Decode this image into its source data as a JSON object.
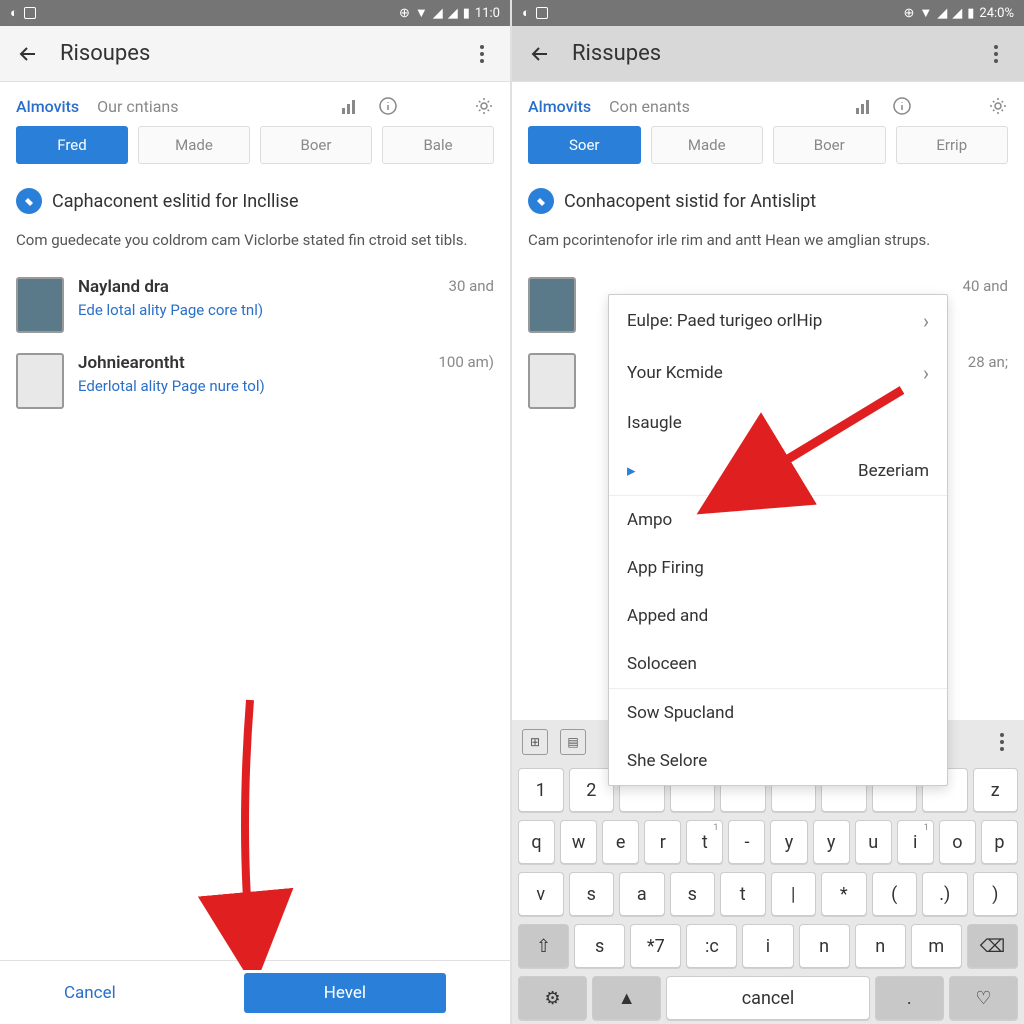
{
  "left": {
    "status": {
      "time": "11:0",
      "signal_glyph": "▲",
      "wifi_glyph": "▼"
    },
    "appbar": {
      "title": "Risoupes"
    },
    "tabs": {
      "a": "Almovits",
      "b": "Our cntians"
    },
    "chips": {
      "c1": "Fred",
      "c2": "Made",
      "c3": "Boer",
      "c4": "Bale"
    },
    "section": {
      "title": "Caphaconent eslitid for Incllise"
    },
    "desc": "Com guedecate you coldrom cam Viclorbe stated fin ctroid set tibls.",
    "items": [
      {
        "title": "Nayland dra",
        "sub": "Ede lotal ality Page core tnl)",
        "meta": "30 and"
      },
      {
        "title": "Johniearontht",
        "sub": "Ederlotal ality Page nure tol)",
        "meta": "100 am)"
      }
    ],
    "footer": {
      "cancel": "Cancel",
      "primary": "Hevel"
    }
  },
  "right": {
    "status": {
      "time": "24:0%"
    },
    "appbar": {
      "title": "Rissupes"
    },
    "tabs": {
      "a": "Almovits",
      "b": "Con enants"
    },
    "chips": {
      "c1": "Soer",
      "c2": "Made",
      "c3": "Boer",
      "c4": "Errip"
    },
    "section": {
      "title": "Conhacopent sistid for Antislipt"
    },
    "desc": "Cam pcorintenofor irle rim and antt Hean we amglian strups.",
    "items": [
      {
        "meta": "40 and"
      },
      {
        "meta": "28 an;"
      }
    ],
    "dropdown": [
      {
        "label": "Eulpe: Paed turigeo orlHip",
        "chevron": true
      },
      {
        "label": "Your Kcmide",
        "chevron": true
      },
      {
        "label": "Isaugle"
      },
      {
        "label": "Bezeriam",
        "marker": true
      },
      {
        "label": "Ampo",
        "sep": true
      },
      {
        "label": "App Firing"
      },
      {
        "label": "Apped and"
      },
      {
        "label": "Soloceen"
      },
      {
        "label": "Sow Spucland",
        "sep": true
      },
      {
        "label": "She Selore"
      }
    ],
    "keyboard": {
      "row1": [
        "1",
        "2",
        "",
        "",
        "",
        "",
        "",
        "",
        "",
        "z"
      ],
      "row1_sup": [
        "",
        "",
        "",
        "",
        "",
        "",
        "",
        "",
        "",
        ""
      ],
      "row2": [
        "q",
        "w",
        "e",
        "r",
        "t",
        "-",
        "y",
        "y",
        "u",
        "i",
        "o",
        "p"
      ],
      "row2_sup": [
        "",
        "",
        "",
        "",
        "1",
        "",
        "",
        "",
        "",
        "1",
        "",
        ""
      ],
      "row3": [
        "v",
        "s",
        "a",
        "s",
        "t",
        "|",
        "*",
        "(",
        ".)",
        ")"
      ],
      "row4": [
        "⇧",
        "s",
        "*7",
        ":c",
        "i",
        "n",
        "n",
        "m",
        "⌫"
      ],
      "row5": [
        "⚙",
        "▲",
        "cancel",
        ".",
        "♡"
      ]
    }
  }
}
